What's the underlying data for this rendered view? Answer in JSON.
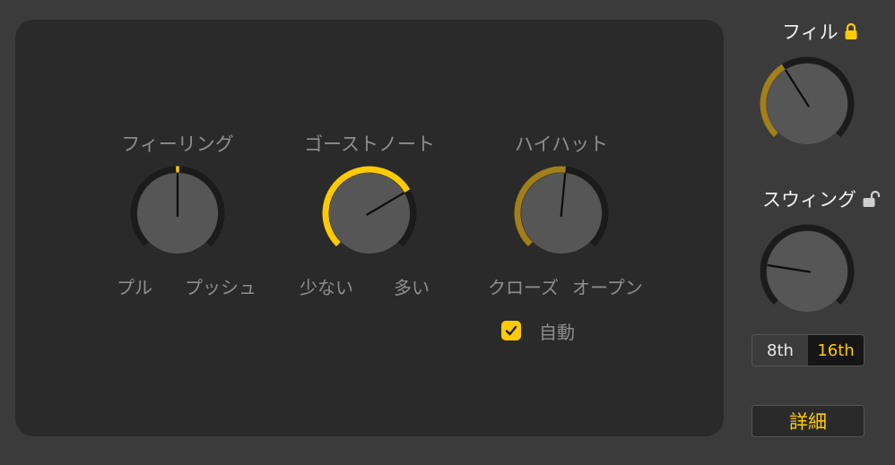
{
  "colors": {
    "accent": "#ffcb00",
    "accent_dim": "#a17f1a",
    "panel": "#2a2a2a",
    "background": "#3b3b3b"
  },
  "knobs": [
    {
      "id": "feel",
      "title": "フィーリング",
      "min_label": "プル",
      "max_label": "プッシュ",
      "value": 0.5,
      "style": "center"
    },
    {
      "id": "ghost",
      "title": "ゴーストノート",
      "min_label": "少ない",
      "max_label": "多い",
      "value": 0.72,
      "style": "bright"
    },
    {
      "id": "hihat",
      "title": "ハイハット",
      "min_label": "クローズ",
      "max_label": "オープン",
      "value": 0.52,
      "style": "dim"
    }
  ],
  "auto": {
    "label": "自動",
    "checked": true
  },
  "fill": {
    "label": "フィル",
    "locked": true,
    "lock_icon": "lock-closed-icon",
    "value": 0.38
  },
  "swing": {
    "label": "スウィング",
    "locked": false,
    "lock_icon": "lock-open-icon",
    "value": 0.2
  },
  "resolution": {
    "options": [
      "8th",
      "16th"
    ],
    "selected": "16th"
  },
  "detail_button": {
    "label": "詳細"
  }
}
